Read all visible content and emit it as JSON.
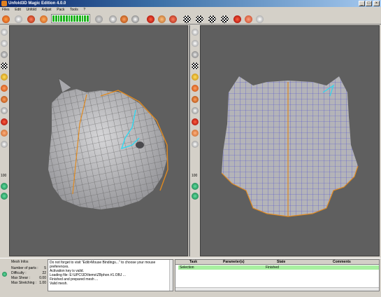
{
  "window": {
    "title": "Unfold3D Magic Edition 4.0.0"
  },
  "menu": [
    "Files",
    "Edit",
    "Unfold",
    "Adjust",
    "Pack",
    "Tools",
    "?"
  ],
  "colors": {
    "viewport_bg": "#5f5f5f",
    "mesh_fill": "#b4b4b8",
    "wire": "#4a4ad0",
    "seam_orange": "#e08a20",
    "seam_cyan": "#30d8f0",
    "progress": "#1db31d",
    "task_ok": "#a8f0a0"
  },
  "mesh_info": {
    "header": "Mesh Infos",
    "rows": [
      {
        "label": "Number of parts :",
        "value": "5"
      },
      {
        "label": "Difficulty :",
        "value": "22"
      },
      {
        "label": "Max Shear :",
        "value": "0.00"
      },
      {
        "label": "Max Stretching :",
        "value": "1.00"
      }
    ]
  },
  "log_lines": [
    "Do not forget to visit \"Edit>Mouse Bindings...\" to choose your mouse preferences.",
    "Activation key is valid.",
    "Loading file: E:\\UPC\\3D\\Items\\ZBphon.#1.OBJ ...",
    "Finished and prepared mesh ...",
    "Valid mesh."
  ],
  "tasks": {
    "columns": [
      "Task",
      "Parameter(s)",
      "State",
      "Comments"
    ],
    "rows": [
      {
        "task": "Selection",
        "params": "",
        "state": "Finished",
        "comments": ""
      }
    ]
  },
  "zoom_label": "100"
}
